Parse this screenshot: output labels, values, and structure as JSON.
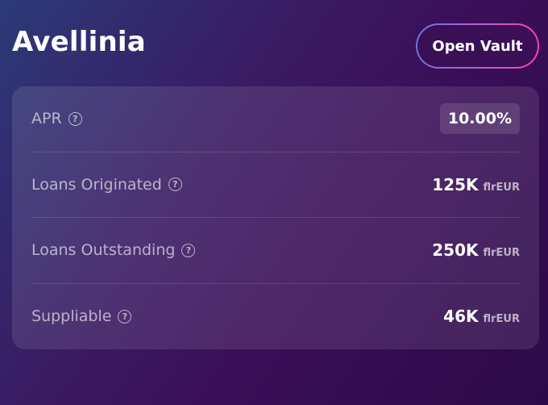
{
  "vault": {
    "name": "Avellinia",
    "open_button_label": "Open Vault"
  },
  "stats": {
    "apr": {
      "label": "APR",
      "value": "10.00%"
    },
    "loans_originated": {
      "label": "Loans Originated",
      "value": "125K",
      "unit": "flrEUR"
    },
    "loans_outstanding": {
      "label": "Loans Outstanding",
      "value": "250K",
      "unit": "flrEUR"
    },
    "suppliable": {
      "label": "Suppliable",
      "value": "46K",
      "unit": "flrEUR"
    }
  },
  "icons": {
    "help": "question-circle-icon"
  },
  "colors": {
    "accent_gradient_start": "#6c74d8",
    "accent_gradient_end": "#ff3fb0",
    "background": "#3a0f58"
  }
}
